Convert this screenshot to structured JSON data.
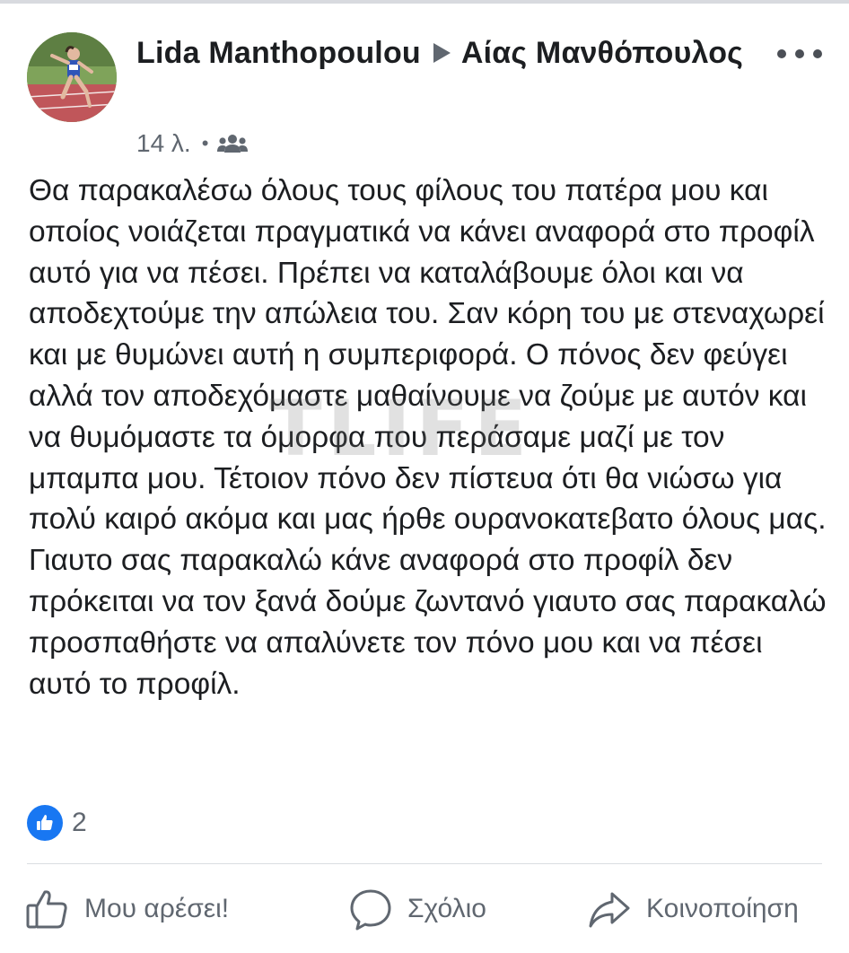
{
  "post": {
    "author": "Lida Manthopoulou",
    "recipient": "Αίας Μανθόπουλος",
    "timestamp": "14 λ.",
    "audience_icon": "friends-icon",
    "text": "Θα παρακαλέσω όλους τους φίλους του πατέρα μου και οποίος νοιάζεται πραγματικά να κάνει αναφορά στο προφίλ αυτό για να πέσει. Πρέπει να καταλάβουμε όλοι και να αποδεχτούμε την απώλεια του. Σαν κόρη του με στεναχωρεί και με θυμώνει αυτή η συμπεριφορά. Ο πόνος δεν φεύγει αλλά τον αποδεχόμαστε μαθαίνουμε να ζούμε με αυτόν και να θυμόμαστε τα όμορφα που περάσαμε μαζί με τον μπαμπα μου. Τέτοιον πόνο δεν πίστευα ότι θα νιώσω  για πολύ καιρό ακόμα και μας ήρθε ουρανοκατεβατο όλους μας. Γιαυτο σας παρακαλώ κάνε αναφορά στο προφίλ δεν πρόκειται να τον ξανά δούμε ζωντανό γιαυτο σας παρακαλώ προσπαθήστε να απαλύνετε τον πόνο μου και να πέσει αυτό το προφίλ."
  },
  "watermark": "TLIFE",
  "reactions": {
    "icon": "like-icon",
    "count": "2"
  },
  "actions": {
    "like_label": "Μου αρέσει!",
    "comment_label": "Σχόλιο",
    "share_label": "Κοινοποίηση"
  },
  "colors": {
    "accent": "#1877f2",
    "text": "#1c1e21",
    "secondary_text": "#606770"
  }
}
